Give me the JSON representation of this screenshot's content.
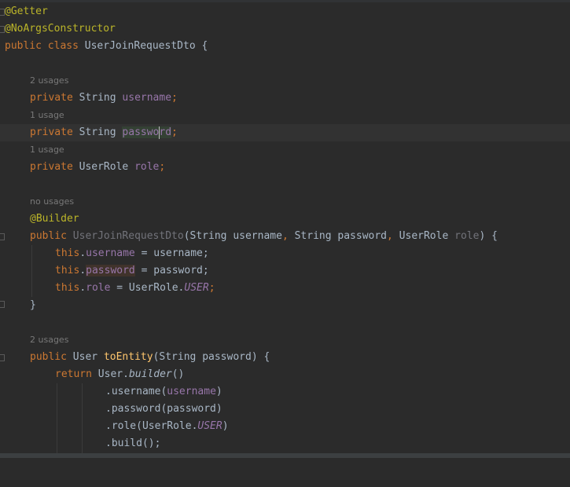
{
  "colors": {
    "background": "#2b2b2b",
    "annotation": "#bbb529",
    "keyword": "#cc7832",
    "field": "#9876aa",
    "method": "#ffc66d",
    "text": "#a9b7c6",
    "hint": "#787878"
  },
  "lines": {
    "l1": {
      "annotation": "@Getter"
    },
    "l2": {
      "annotation": "@NoArgsConstructor"
    },
    "l3": {
      "kw_public": "public",
      "kw_class": "class",
      "name": "UserJoinRequestDto",
      "brace": "{"
    },
    "h1": "2 usages",
    "l5": {
      "kw": "private",
      "type": "String",
      "field": "username",
      "semi": ";"
    },
    "h2": "1 usage",
    "l7": {
      "kw": "private",
      "type": "String",
      "field_a": "passwo",
      "field_b": "rd",
      "semi": ";"
    },
    "h3": "1 usage",
    "l9": {
      "kw": "private",
      "type": "UserRole",
      "field": "role",
      "semi": ";"
    },
    "h4": "no usages",
    "l11": {
      "annotation": "@Builder"
    },
    "l12": {
      "kw": "public",
      "name": "UserJoinRequestDto",
      "open": "(",
      "t1": "String",
      "p1": "username",
      "c1": ",",
      "t2": "String",
      "p2": "password",
      "c2": ",",
      "t3": "UserRole",
      "p3": "role",
      "close": ") {"
    },
    "l13": {
      "this": "this",
      "dot": ".",
      "field": "username",
      "rest": " = username;"
    },
    "l14": {
      "this": "this",
      "dot": ".",
      "field": "password",
      "rest": " = password;"
    },
    "l15": {
      "this": "this",
      "dot": ".",
      "field": "role",
      "eq": " = UserRole.",
      "constant": "USER",
      "semi": ";"
    },
    "l16": {
      "brace": "}"
    },
    "h5": "2 usages",
    "l18": {
      "kw": "public",
      "type": "User",
      "method": "toEntity",
      "open": "(",
      "ptype": "String",
      "param": "password",
      "close": ") {"
    },
    "l19": {
      "kw": "return",
      "obj": "User.",
      "method": "builder",
      "parens": "()"
    },
    "l20": {
      "call": ".username(",
      "arg": "username",
      "close": ")"
    },
    "l21": {
      "call": ".password(password)"
    },
    "l22": {
      "call": ".role(UserRole.",
      "constant": "USER",
      "close": ")"
    },
    "l23": {
      "call": ".build();"
    }
  }
}
